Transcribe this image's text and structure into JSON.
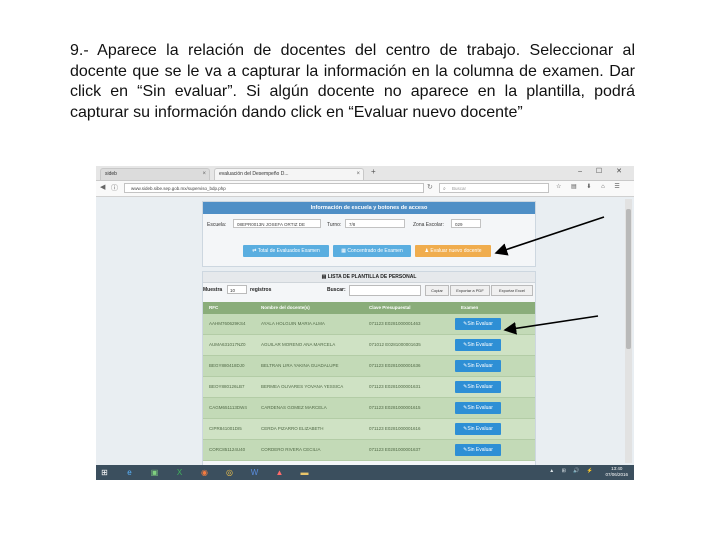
{
  "instruction": "9.- Aparece la relación de docentes del centro de trabajo. Seleccionar al docente que se le va a capturar la información en la columna de examen. Dar click en “Sin evaluar”. Si algún docente no aparece en la plantilla, podrá capturar su información dando click en “Evaluar nuevo docente”",
  "browser": {
    "tab1": "sideb",
    "tab2": "evaluación del Desempeño D...",
    "new_tab": "+",
    "url": "www.sideb.sibe.sep.gob.mx/superviso_bdp.php",
    "search_placeholder": "Buscar",
    "window_controls": "–  ☐  ✕"
  },
  "info_panel": {
    "title": "Información de escuela y botones de acceso",
    "escuela_label": "Escuela:",
    "escuela_value": "08EPR0013N JOSEFA ORTIZ DE",
    "turno_label": "Turno:",
    "turno_value": "7/8",
    "zona_label": "Zona Escolar:",
    "zona_value": "029",
    "btn_total": "Total de Evaluados Examen",
    "btn_concentrado": "Concentrado de Examen",
    "btn_evaluar_nuevo": "Evaluar nuevo docente"
  },
  "staff_panel": {
    "title": "LISTA DE PLANTILLA DE PERSONAL",
    "show_label": "Muestra",
    "show_value": "10",
    "registros_label": "registros",
    "buscar_label": "Buscar:",
    "btn_copiar": "Copiar",
    "btn_pdf": "Exportar a PDF",
    "btn_excel": "Exportar Excel",
    "columns": [
      "RFC",
      "Nombre del docente(s)",
      "Clave Presupuestal",
      "Examen"
    ],
    "rows": [
      {
        "rfc": "AAHM760629KS4",
        "name": "AYALA HOLGUIN MARIA ALMA",
        "clave": "071123 E0281000001463",
        "exam": "Sin Evaluar"
      },
      {
        "rfc": "AUMA631017NZ0",
        "name": "AGUILAR MORENO ANA MARCELA",
        "clave": "071012 E0281000001635",
        "exam": "Sin Evaluar"
      },
      {
        "rfc": "BEGY880418DJ0",
        "name": "BELTRAN LIRA YAKINA GUADALUPE",
        "clave": "071123 E0281000001636",
        "exam": "Sin Evaluar"
      },
      {
        "rfc": "BEOY880126LB7",
        "name": "BERMEA OLIVARES YOVANA YESSICA",
        "clave": "071123 E0281000001631",
        "exam": "Sin Evaluar"
      },
      {
        "rfc": "CAGM651113DW4",
        "name": "CARDENAS GOMEZ MARCELA",
        "clave": "071123 E0281000001615",
        "exam": "Sin Evaluar"
      },
      {
        "rfc": "CIPR841001DI5",
        "name": "CERDA PIZARRO ELIZABETH",
        "clave": "071123 E0281000001616",
        "exam": "Sin Evaluar"
      },
      {
        "rfc": "CORC851124U40",
        "name": "CORDERO RIVERA CECILIA",
        "clave": "071123 E0281000001637",
        "exam": "Sin Evaluar"
      }
    ]
  },
  "taskbar": {
    "icons": [
      "windows-icon",
      "ie-icon",
      "store-icon",
      "excel-icon",
      "word-icon",
      "firefox-icon",
      "chrome-icon",
      "acrobat-icon",
      "folder-icon"
    ],
    "tray": "▲ ⊞ 🔊 ⚡",
    "time": "13:40",
    "date": "07/06/2016"
  },
  "colors": {
    "header_blue": "#4f8fc6",
    "btn_light_blue": "#5aaee0",
    "btn_orange": "#f0ad4e",
    "table_green": "#c3dab7",
    "sin_evaluar_blue": "#2e8fd5",
    "arrow": "#000000"
  }
}
